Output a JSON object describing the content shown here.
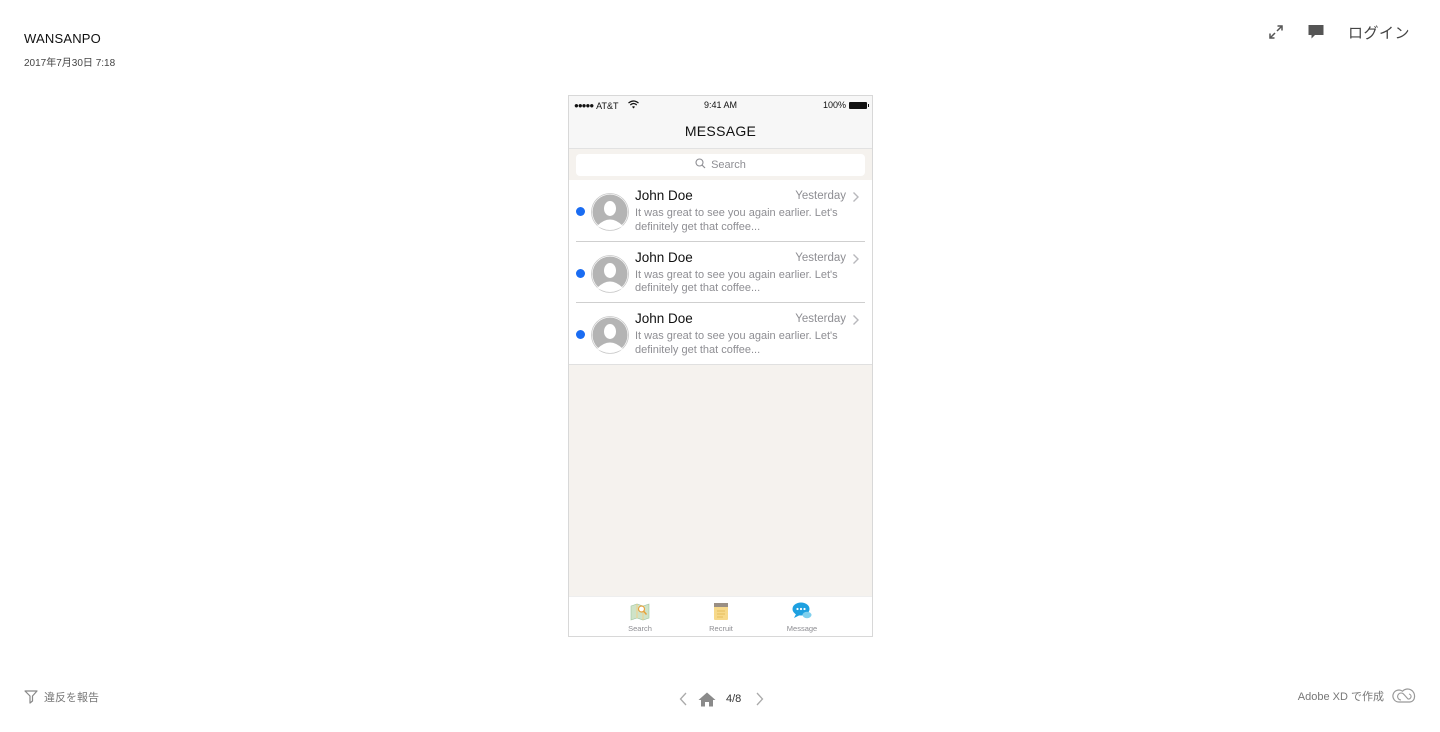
{
  "document": {
    "title": "WANSANPO",
    "date": "2017年7月30日 7:18"
  },
  "top_actions": {
    "expand_icon": "expand-icon",
    "comment_icon": "comment-icon",
    "login_label": "ログイン"
  },
  "artboard": {
    "status_bar": {
      "signal_dots": "●●●●●",
      "carrier": "AT&T",
      "wifi_icon": "wifi-icon",
      "time": "9:41 AM",
      "battery": "100%"
    },
    "nav_title": "MESSAGE",
    "search": {
      "placeholder": "Search",
      "icon": "search-icon"
    },
    "messages": [
      {
        "name": "John Doe",
        "time": "Yesterday",
        "preview_line1": "It was great to see you again earlier. Let's",
        "preview_line2": "definitely get that coffee...",
        "unread": true
      },
      {
        "name": "John Doe",
        "time": "Yesterday",
        "preview_line1": "It was great to see you again earlier. Let's",
        "preview_line2": "definitely get that coffee...",
        "unread": true
      },
      {
        "name": "John Doe",
        "time": "Yesterday",
        "preview_line1": "It was great to see you again earlier. Let's",
        "preview_line2": "definitely get that coffee...",
        "unread": true
      }
    ],
    "tabbar": [
      {
        "label": "Search",
        "icon": "map-search-icon"
      },
      {
        "label": "Recruit",
        "icon": "notepad-icon"
      },
      {
        "label": "Message",
        "icon": "chat-bubble-icon"
      }
    ],
    "colors": {
      "unread_dot": "#1a6cf2",
      "message_tab_icon": "#1ea0e0",
      "background": "#f5f2ee"
    }
  },
  "footer": {
    "report_label": "違反を報告",
    "page_indicator": "4/8",
    "made_with": "Adobe XD で作成"
  }
}
